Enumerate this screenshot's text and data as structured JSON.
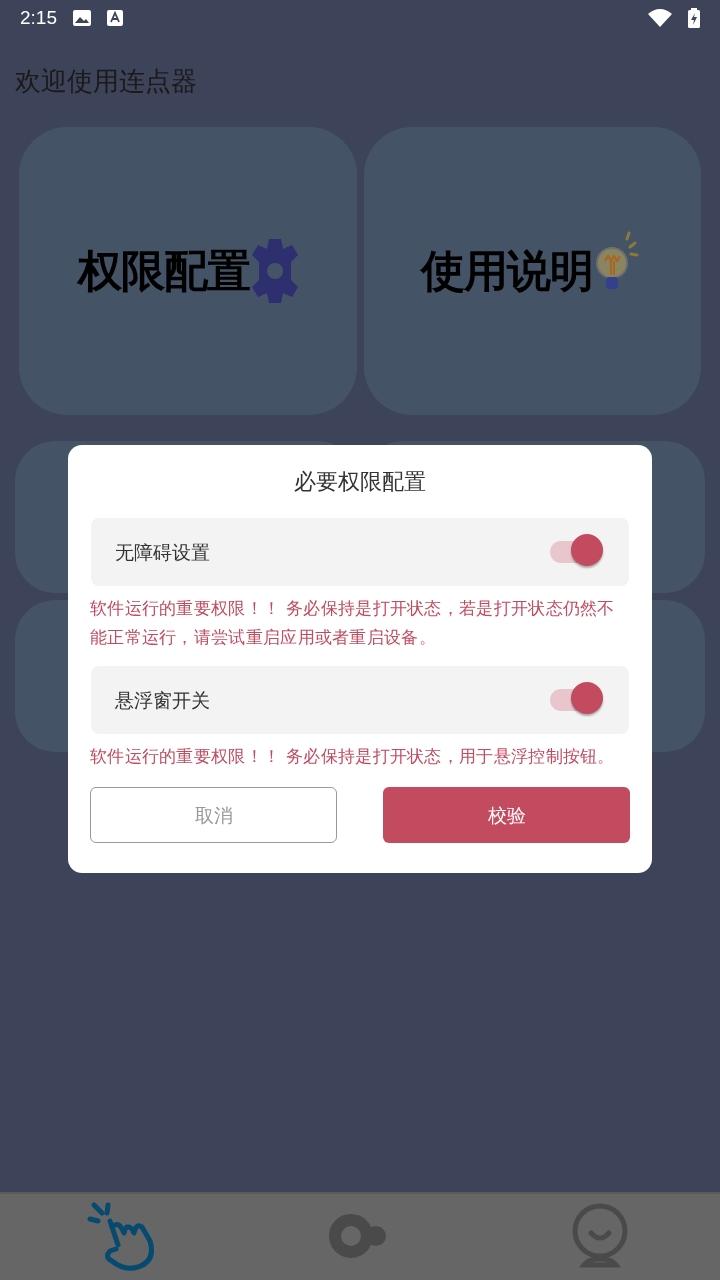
{
  "status_bar": {
    "time": "2:15"
  },
  "title": "欢迎使用连点器",
  "cards": [
    {
      "label": "权限配置",
      "kind": "gear"
    },
    {
      "label": "使用说明",
      "kind": "bulb"
    }
  ],
  "dialog": {
    "title": "必要权限配置",
    "permissions": [
      {
        "label": "无障碍设置",
        "on": true,
        "note": "软件运行的重要权限！！ 务必保持是打开状态，若是打开状态仍然不能正常运行，请尝试重启应用或者重启设备。"
      },
      {
        "label": "悬浮窗开关",
        "on": true,
        "note": "软件运行的重要权限！！ 务必保持是打开状态，用于悬浮控制按钮。"
      }
    ],
    "cancel": "取消",
    "confirm": "校验"
  },
  "nav": [
    {
      "kind": "hand",
      "selected": true
    },
    {
      "kind": "circles",
      "selected": false
    },
    {
      "kind": "face",
      "selected": false
    }
  ]
}
